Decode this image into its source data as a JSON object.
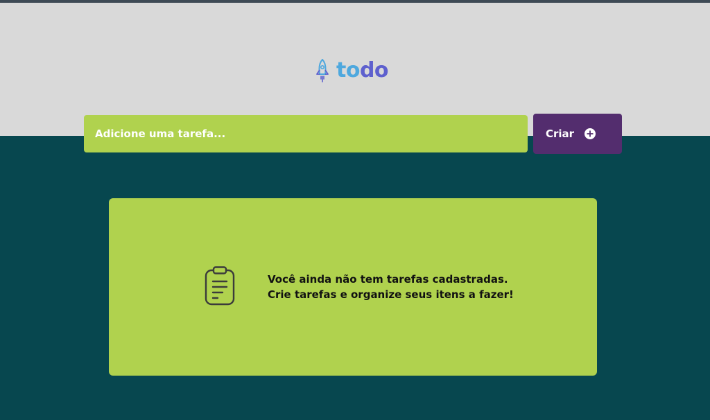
{
  "header": {
    "logo_part1": "to",
    "logo_part2": "do",
    "logo_icon": "rocket-icon"
  },
  "new_task": {
    "placeholder": "Adicione uma tarefa...",
    "value": "",
    "create_label": "Criar",
    "create_icon": "plus-circle-icon"
  },
  "empty_state": {
    "icon": "clipboard-icon",
    "line1": "Você ainda não tem tarefas cadastradas.",
    "line2": "Crie tarefas e organize seus itens a fazer!"
  },
  "colors": {
    "header_background": "#d9d9d9",
    "page_background": "#07474f",
    "accent_green": "#b0d24e",
    "button_purple": "#532d6e",
    "logo_blue": "#4ea8de",
    "logo_purple": "#5e60ce"
  }
}
